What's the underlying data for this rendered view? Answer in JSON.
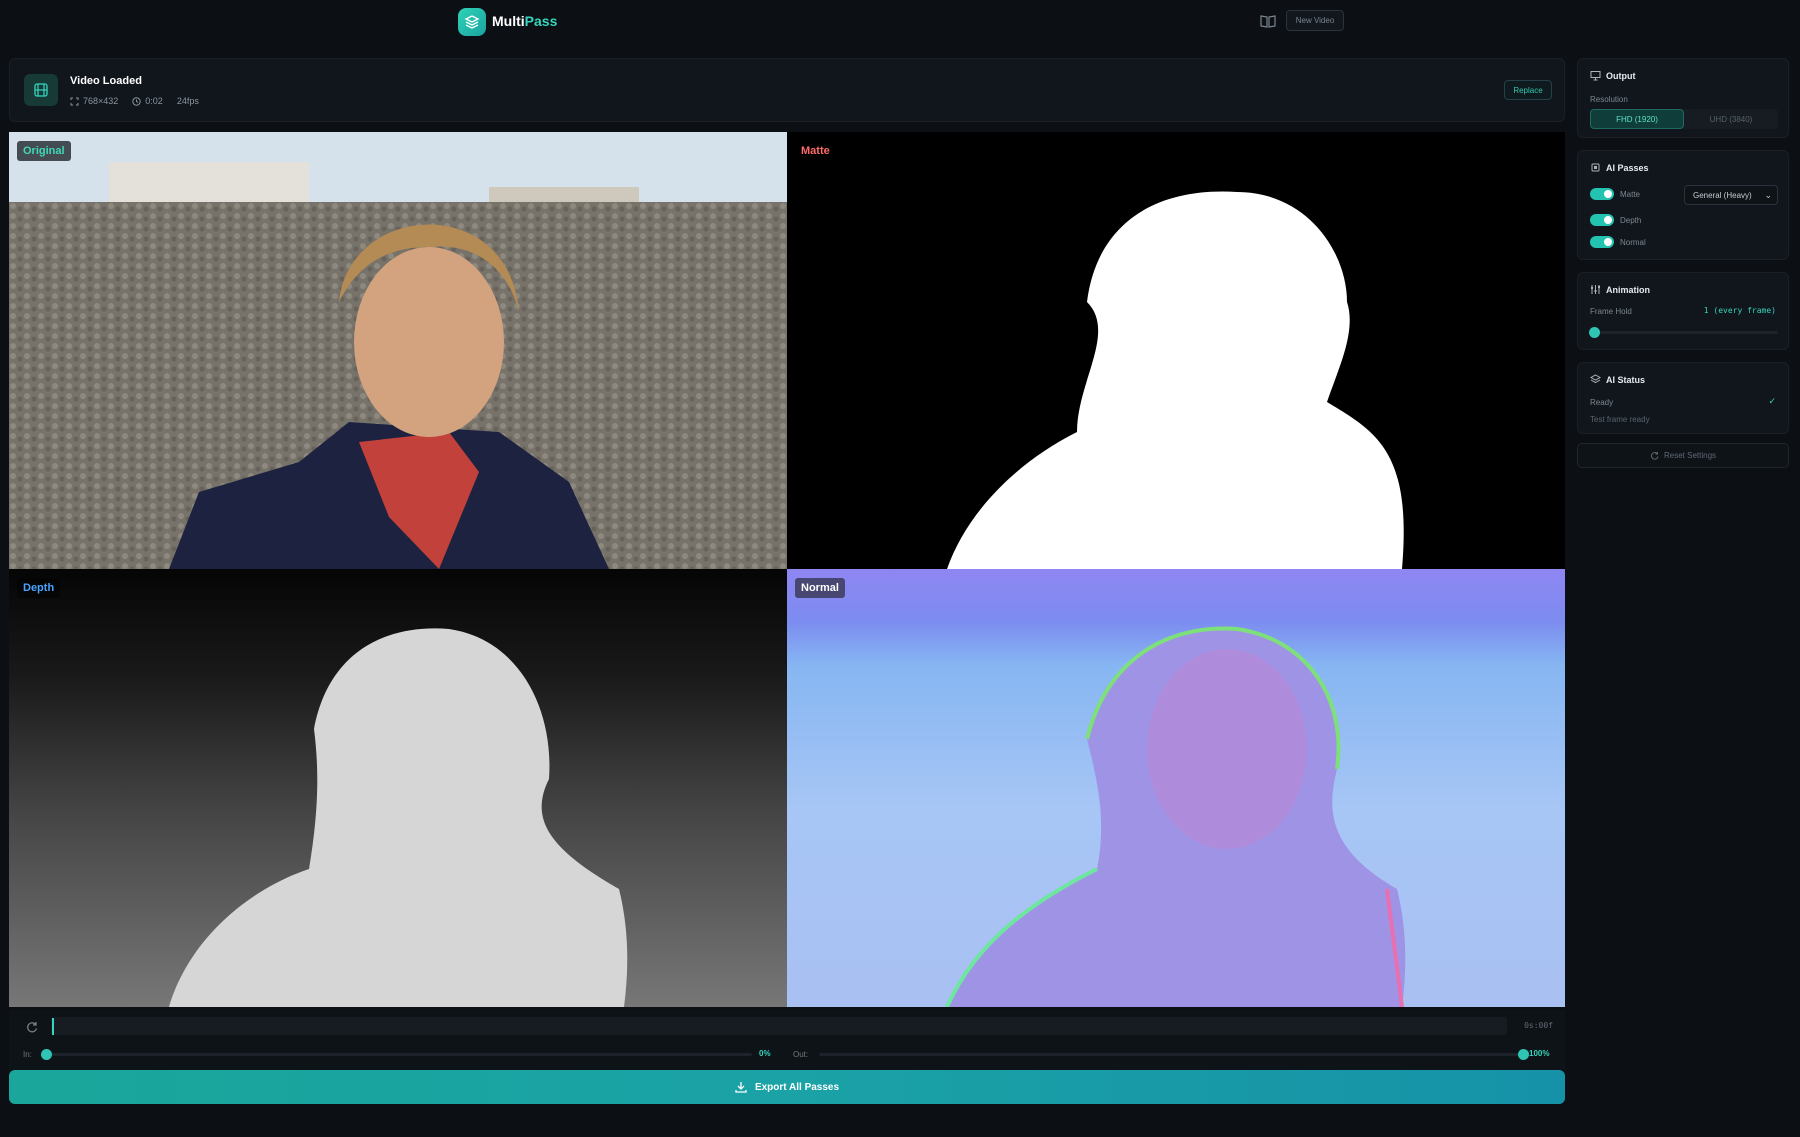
{
  "app": {
    "brand_a": "Multi",
    "brand_b": "Pass"
  },
  "header": {
    "new_video_label": "New Video"
  },
  "video": {
    "title": "Video Loaded",
    "resolution": "768×432",
    "duration": "0:02",
    "fps": "24fps",
    "replace_label": "Replace"
  },
  "passes": {
    "original": "Original",
    "matte": "Matte",
    "depth": "Depth",
    "normal": "Normal"
  },
  "timeline": {
    "timecode": "0s:00f",
    "in_label": "In:",
    "in_pct": "0%",
    "out_label": "Out:",
    "out_pct": "100%",
    "in_value": 0,
    "out_value": 1
  },
  "export": {
    "label": "Export All Passes"
  },
  "sidebar": {
    "output": {
      "title": "Output",
      "resolution_label": "Resolution",
      "options": [
        "FHD (1920)",
        "UHD (3840)"
      ],
      "selected": "FHD (1920)"
    },
    "ai_passes": {
      "title": "AI Passes",
      "items": [
        {
          "label": "Matte",
          "enabled": true
        },
        {
          "label": "Depth",
          "enabled": true
        },
        {
          "label": "Normal",
          "enabled": true
        }
      ],
      "matte_model": "General (Heavy)"
    },
    "animation": {
      "title": "Animation",
      "frame_hold_label": "Frame Hold",
      "frame_hold_value": "1 (every frame)",
      "frame_hold_level": 0
    },
    "ai_status": {
      "title": "AI Status",
      "status": "Ready",
      "check": "✓",
      "detail": "Test frame ready"
    },
    "reset_label": "Reset Settings"
  },
  "colors": {
    "accent": "#36d5bd",
    "matte_badge": "#ff6a6a",
    "depth_badge": "#4aa3ff"
  }
}
